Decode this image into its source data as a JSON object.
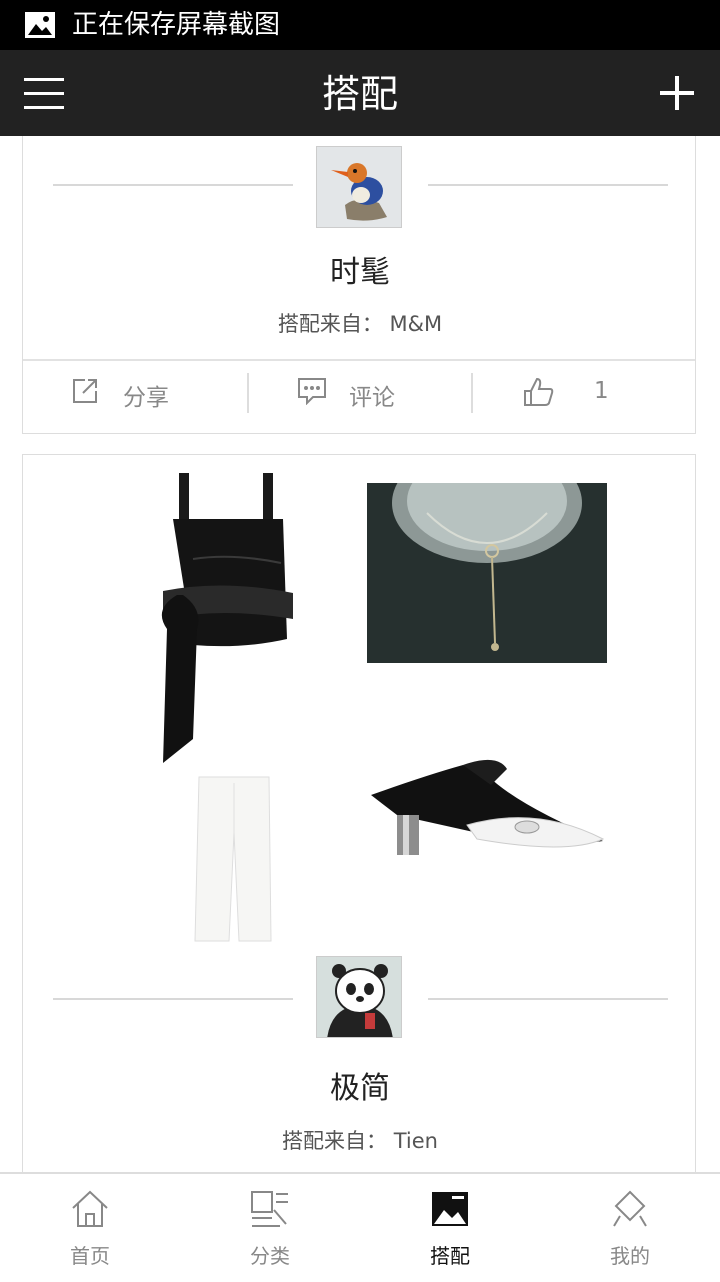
{
  "status_bar": {
    "text": "正在保存屏幕截图"
  },
  "header": {
    "title": "搭配"
  },
  "posts": [
    {
      "title": "时髦",
      "source_label": "搭配来自：",
      "author": "M&M",
      "actions": {
        "share": "分享",
        "comment": "评论",
        "likes": "1"
      }
    },
    {
      "title": "极简",
      "source_label": "搭配来自：",
      "author": "Tien",
      "items": [
        "black-satin-top",
        "necklace-photo",
        "white-trousers",
        "black-white-mule"
      ]
    }
  ],
  "bottom_nav": {
    "tabs": [
      {
        "label": "首页",
        "icon": "home-icon"
      },
      {
        "label": "分类",
        "icon": "category-icon"
      },
      {
        "label": "搭配",
        "icon": "outfit-icon",
        "active": true
      },
      {
        "label": "我的",
        "icon": "profile-icon"
      }
    ]
  }
}
